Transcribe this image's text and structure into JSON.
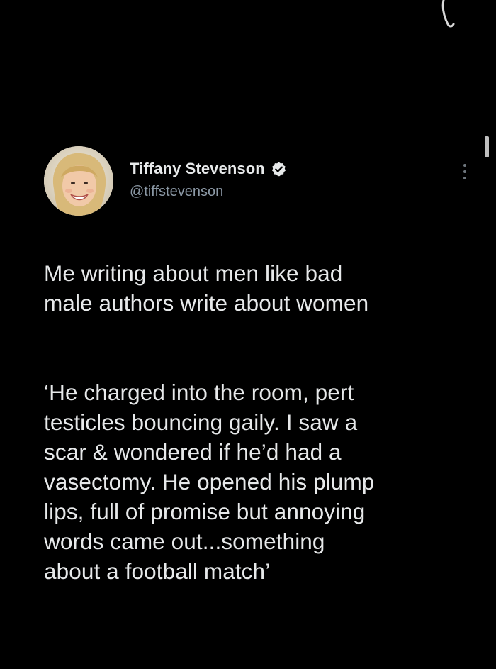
{
  "tweet": {
    "display_name": "Tiffany Stevenson",
    "handle": "@tiffstevenson",
    "verified": true,
    "paragraphs": [
      "Me writing about men like bad\nmale authors write about women",
      "‘He charged into the room, pert\ntesticles bouncing gaily. I saw a\nscar & wondered if he’d had a\nvasectomy.  He opened his plump\nlips, full of promise but annoying\nwords came out...something\nabout a football match’"
    ]
  },
  "icons": {
    "verified": "verified-badge-icon",
    "more": "more-options-icon",
    "avatar": "profile-photo"
  },
  "colors": {
    "background": "#000000",
    "text_primary": "#e7e9ea",
    "text_secondary": "#8b98a5",
    "badge": "#e7e9ea"
  }
}
